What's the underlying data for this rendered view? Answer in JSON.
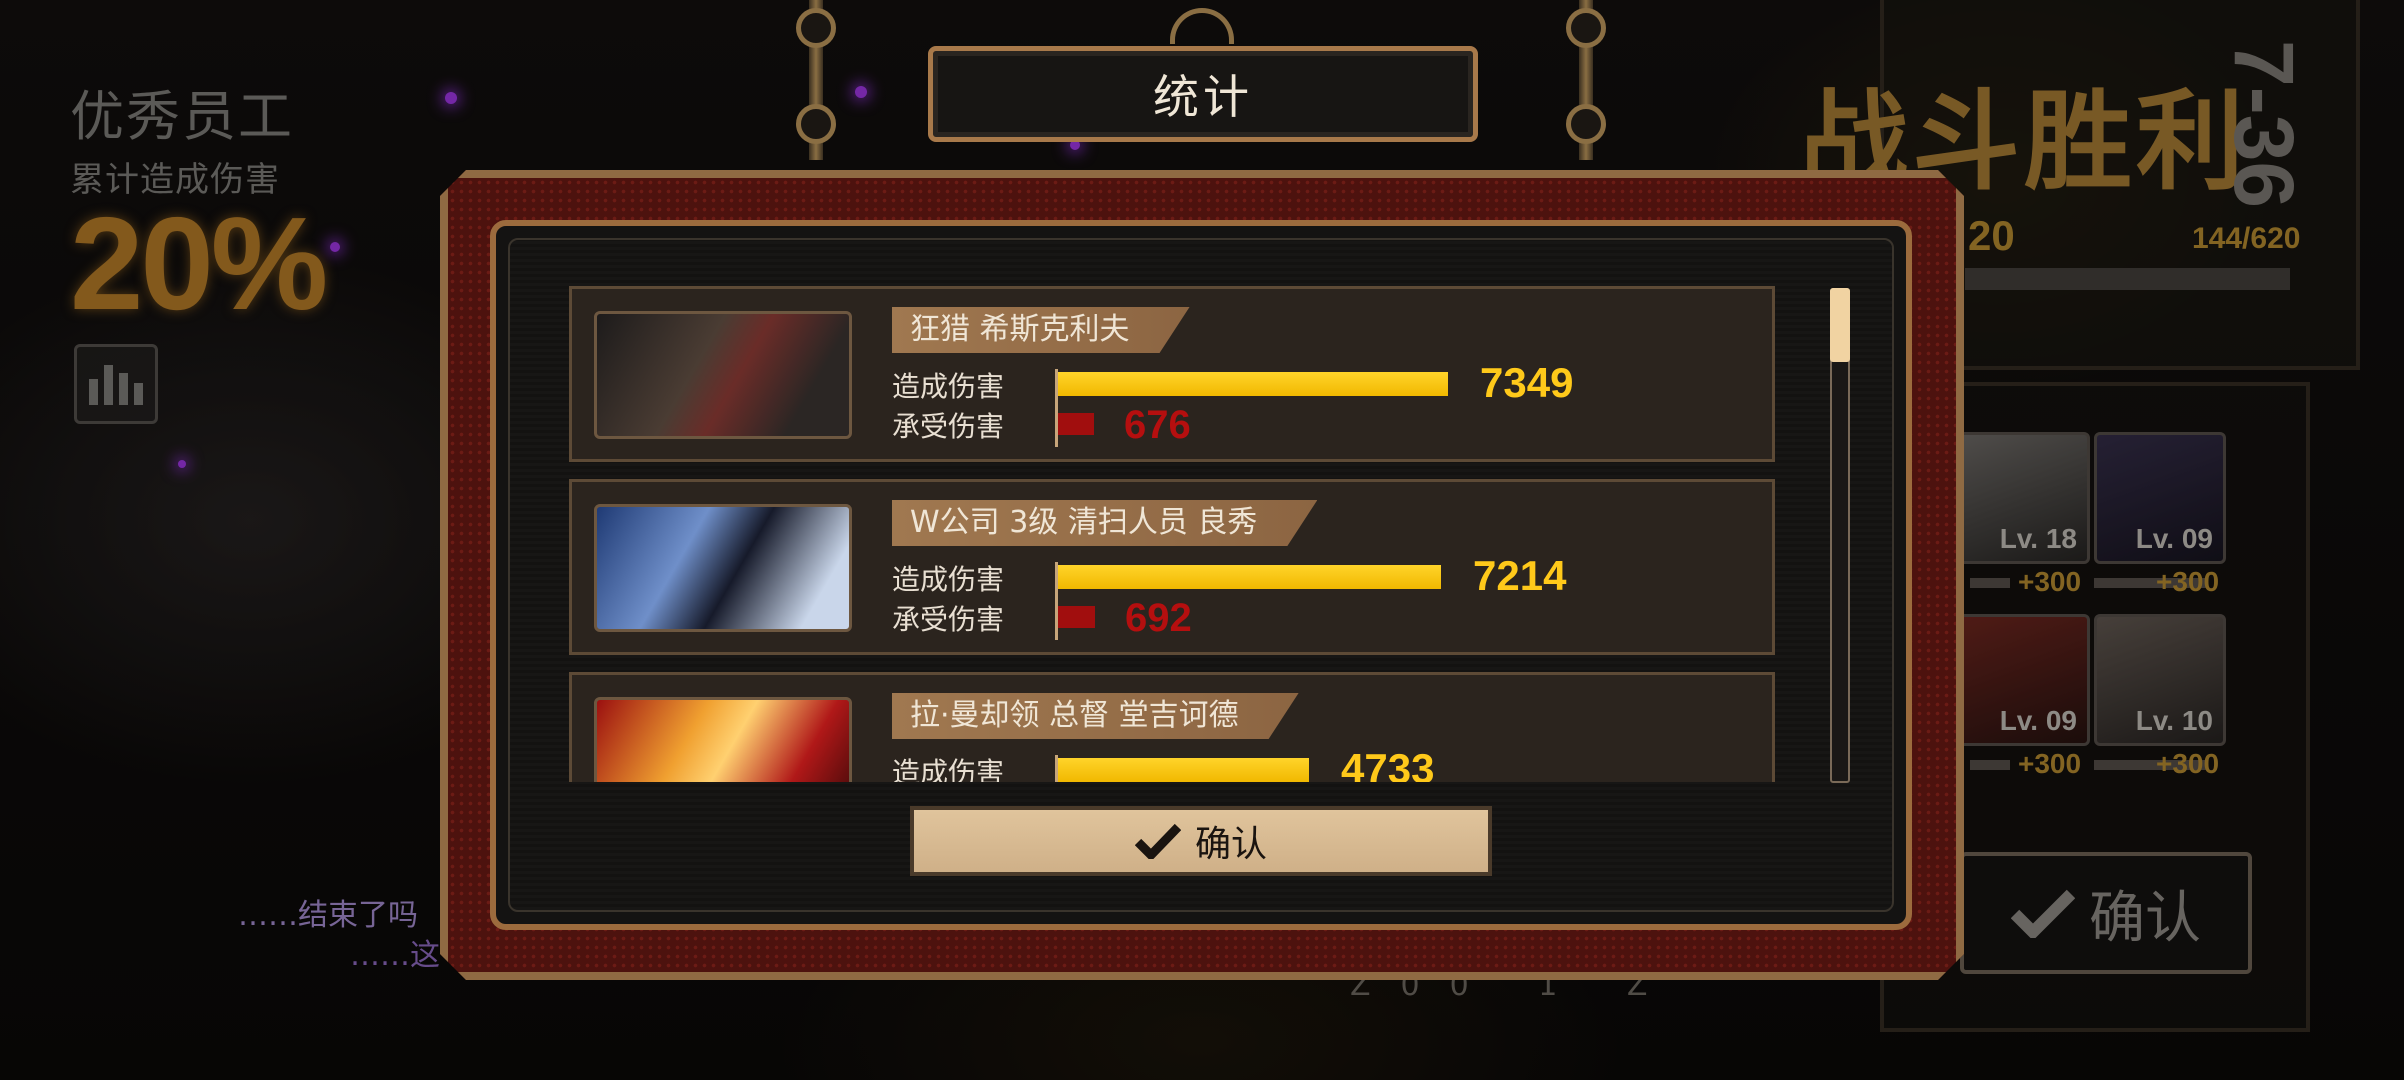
{
  "left": {
    "title": "优秀员工",
    "subtitle": "累计造成伤害",
    "percent": "20%"
  },
  "dialogue": {
    "line1_prefix": "……",
    "line1_text": "结束了吗",
    "line2_prefix": "……",
    "line2_text": "这"
  },
  "result": {
    "victory_text": "战斗胜利",
    "stage": "7-36",
    "level": "20",
    "exp": "144/620",
    "characters": [
      {
        "level": "Lv. 18",
        "reward": "+300"
      },
      {
        "level": "Lv. 09",
        "reward": "+300"
      },
      {
        "level": "Lv. 09",
        "reward": "+300"
      },
      {
        "level": "Lv. 10",
        "reward": "+300"
      }
    ],
    "confirm_label": "确认",
    "bottom_text": "Z00 1 Z"
  },
  "modal": {
    "title": "统计",
    "dealt_label": "造成伤害",
    "taken_label": "承受伤害",
    "confirm_label": "确认",
    "entries": [
      {
        "name": "狂猎 希斯克利夫",
        "dealt": "7349",
        "taken": "676",
        "dealt_value": 7349,
        "taken_value": 676
      },
      {
        "name": "W公司 3级 清扫人员 良秀",
        "dealt": "7214",
        "taken": "692",
        "dealt_value": 7214,
        "taken_value": 692
      },
      {
        "name": "拉·曼却领 总督 堂吉诃德",
        "dealt": "4733",
        "taken": "",
        "dealt_value": 4733,
        "taken_value": null
      }
    ]
  },
  "colors": {
    "dealt_bar": "#ffc91a",
    "taken_bar": "#a10e0e",
    "accent_bronze": "#9c6b3d",
    "victory_gold": "#b8893a"
  },
  "icons": [
    "stats-bars-icon",
    "check-icon"
  ]
}
